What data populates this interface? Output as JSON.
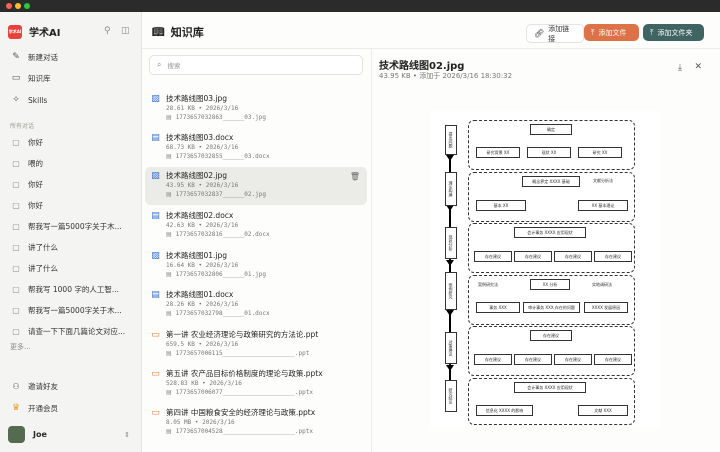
{
  "app": {
    "name": "学术AI",
    "logo_text": "学术AI"
  },
  "sidebar": {
    "nav": [
      {
        "label": "新建对话",
        "icon": "edit-icon"
      },
      {
        "label": "知识库",
        "icon": "book-icon"
      },
      {
        "label": "Skills",
        "icon": "wand-icon"
      }
    ],
    "section_label": "所有对话",
    "conversations": [
      "你好",
      "喂的",
      "你好",
      "你好",
      "帮我写一篇5000字关于木...",
      "讲了什么",
      "讲了什么",
      "帮我写 1000 字的人工智...",
      "帮我写一篇5000字关于木...",
      "请查一下下面几篇论文对应..."
    ],
    "more_label": "更多...",
    "invite_label": "邀请好友",
    "member_label": "开通会员",
    "user_name": "Joe"
  },
  "header": {
    "title": "知识库",
    "add_link": "添加链接",
    "add_file": "添加文件",
    "add_folder": "添加文件夹"
  },
  "search": {
    "placeholder": "搜索"
  },
  "files": [
    {
      "name": "技术路线图03.jpg",
      "meta": "28.61 KB • 2026/3/16",
      "path": "1773657032863______03.jpg",
      "type": "img"
    },
    {
      "name": "技术路线图03.docx",
      "meta": "68.73 KB • 2026/3/16",
      "path": "1773657032855______03.docx",
      "type": "doc"
    },
    {
      "name": "技术路线图02.jpg",
      "meta": "43.95 KB • 2026/3/16",
      "path": "1773657032837______02.jpg",
      "type": "img"
    },
    {
      "name": "技术路线图02.docx",
      "meta": "42.63 KB • 2026/3/16",
      "path": "1773657032816______02.docx",
      "type": "doc"
    },
    {
      "name": "技术路线图01.jpg",
      "meta": "16.64 KB • 2026/3/16",
      "path": "1773657032806______01.jpg",
      "type": "img"
    },
    {
      "name": "技术路线图01.docx",
      "meta": "28.26 KB • 2026/3/16",
      "path": "1773657032798______01.docx",
      "type": "doc"
    },
    {
      "name": "第一讲 农业经济理论与政策研究的方法论.ppt",
      "meta": "659.5 KB • 2026/3/16",
      "path": "1773657006115____________________.ppt",
      "type": "ppt"
    },
    {
      "name": "第五讲 农产品目标价格制度的理论与政策.pptx",
      "meta": "528.83 KB • 2026/3/16",
      "path": "1773657006077____________________.pptx",
      "type": "ppt"
    },
    {
      "name": "第四讲 中国粮食安全的经济理论与政策.pptx",
      "meta": "8.05 MB • 2026/3/16",
      "path": "1773657004528____________________.pptx",
      "type": "ppt"
    }
  ],
  "preview": {
    "title": "技术路线图02.jpg",
    "meta": "43.95 KB • 添加于 2026/3/16 18:30:32",
    "diagram": {
      "stages": [
        "提出问题",
        "理论构建",
        "现状分析",
        "案例研究",
        "对策建议",
        "研究结论"
      ],
      "s1_top": "确定",
      "s1_sub": [
        "研究背景 XX",
        "现状 XX",
        "研究 XX"
      ],
      "s2_top": "概念界定 XXXX 基础",
      "s2_right": "文献分析法",
      "s2_sub": [
        "基本 XX",
        "XX 基本理论"
      ],
      "s3_top": "会计事务 XXXX 应用现状",
      "s3_sub": [
        "存在建议",
        "存在建议",
        "存在建议",
        "存在建议"
      ],
      "s4_left": "案例研究法",
      "s4_mid": "XX 分析",
      "s4_right": "实地调研法",
      "s4_sub": [
        "事务 XXX",
        "审计事务 XXX 存在的问题",
        "XXXX 发展原因"
      ],
      "s5_top": "存在建议",
      "s5_sub": [
        "存在建议",
        "存在建议",
        "存在建议",
        "存在建议"
      ],
      "s6_top": "会计事务 XXXX 应用现状",
      "s6_sub": [
        "信息化 XXXX 的影响",
        "文献 XXX"
      ]
    }
  }
}
